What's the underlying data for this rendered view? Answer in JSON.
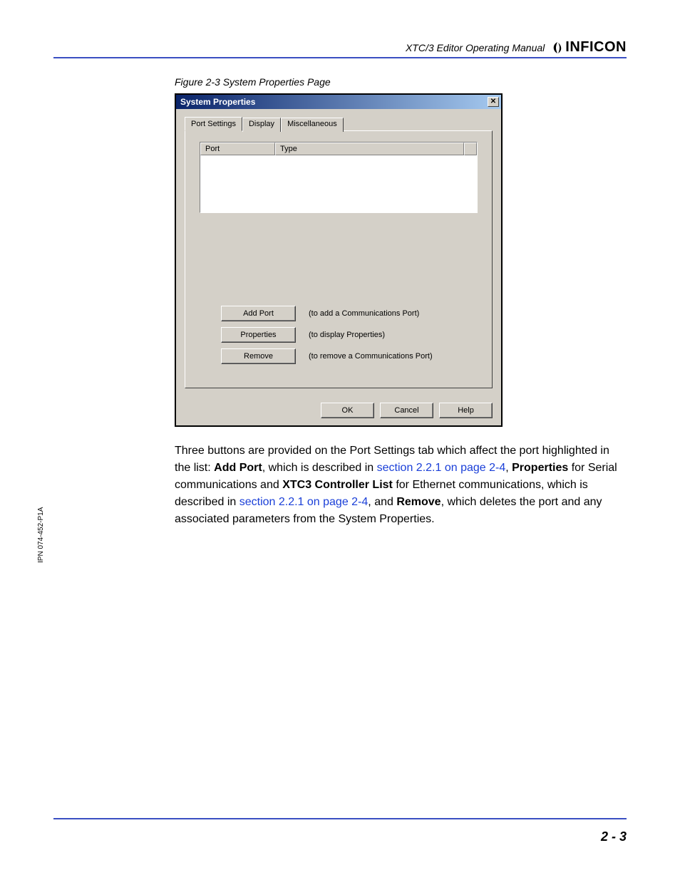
{
  "header": {
    "doc_title": "XTC/3 Editor Operating Manual",
    "brand": "INFICON"
  },
  "figure_caption": "Figure 2-3  System Properties Page",
  "dialog": {
    "title": "System Properties",
    "tabs": [
      "Port Settings",
      "Display",
      "Miscellaneous"
    ],
    "list_columns": [
      "Port",
      "Type"
    ],
    "buttons": [
      {
        "label": "Add Port",
        "desc": "(to add a Communications Port)"
      },
      {
        "label": "Properties",
        "desc": "(to display Properties)"
      },
      {
        "label": "Remove",
        "desc": "(to remove a Communications Port)"
      }
    ],
    "footer": [
      "OK",
      "Cancel",
      "Help"
    ]
  },
  "paragraph": {
    "t1": "Three buttons are provided on the Port Settings tab which affect the port highlighted in the list: ",
    "b1": "Add Port",
    "t2": ", which is described in ",
    "l1": "section 2.2.1 on page 2-4",
    "t3": ", ",
    "b2": "Properties",
    "t4": " for Serial communications and ",
    "b3": "XTC3 Controller List",
    "t5": " for Ethernet communications, which is described in ",
    "l2": "section 2.2.1 on page 2-4",
    "t6": ", and ",
    "b4": "Remove",
    "t7": ", which deletes the port and any associated parameters from the System Properties."
  },
  "side": "IPN 074-452-P1A",
  "page_number": "2 - 3"
}
